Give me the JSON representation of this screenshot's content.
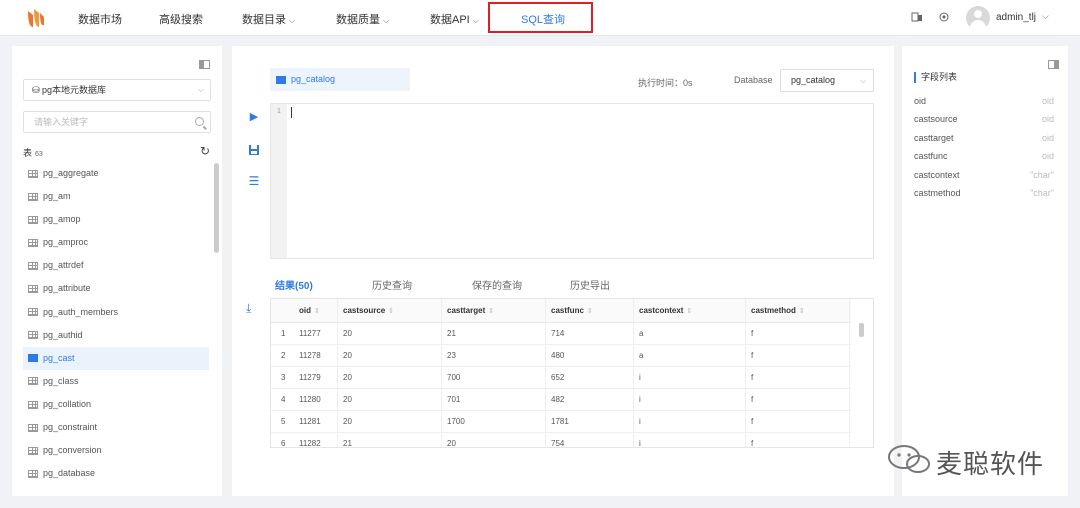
{
  "nav": {
    "items": [
      {
        "label": "数据市场",
        "dropdown": false
      },
      {
        "label": "高级搜索",
        "dropdown": false
      },
      {
        "label": "数据目录",
        "dropdown": true
      },
      {
        "label": "数据质量",
        "dropdown": true
      },
      {
        "label": "数据API",
        "dropdown": true
      },
      {
        "label": "SQL查询",
        "dropdown": false,
        "active": true
      }
    ],
    "username": "admin_tlj",
    "icons": [
      "notification-icon",
      "settings-icon"
    ]
  },
  "left": {
    "datasource": "pg本地元数据库",
    "search_placeholder": "请输入关键字",
    "table_label": "表",
    "table_count": "63",
    "tables": [
      "pg_aggregate",
      "pg_am",
      "pg_amop",
      "pg_amproc",
      "pg_attrdef",
      "pg_attribute",
      "pg_auth_members",
      "pg_authid",
      "pg_cast",
      "pg_class",
      "pg_collation",
      "pg_constraint",
      "pg_conversion",
      "pg_database"
    ],
    "selected_table": "pg_cast"
  },
  "editor": {
    "tab_label": "pg_catalog",
    "exec_time": "执行时间：0s",
    "database_label": "Database",
    "database_value": "pg_catalog",
    "line_number": "1"
  },
  "results": {
    "tabs": [
      "结果(50)",
      "历史查询",
      "保存的查询",
      "历史导出"
    ],
    "columns": [
      "oid",
      "castsource",
      "casttarget",
      "castfunc",
      "castcontext",
      "castmethod"
    ],
    "rows": [
      [
        "1",
        "11277",
        "20",
        "21",
        "714",
        "a",
        "f"
      ],
      [
        "2",
        "11278",
        "20",
        "23",
        "480",
        "a",
        "f"
      ],
      [
        "3",
        "11279",
        "20",
        "700",
        "652",
        "i",
        "f"
      ],
      [
        "4",
        "11280",
        "20",
        "701",
        "482",
        "i",
        "f"
      ],
      [
        "5",
        "11281",
        "20",
        "1700",
        "1781",
        "i",
        "f"
      ],
      [
        "6",
        "11282",
        "21",
        "20",
        "754",
        "i",
        "f"
      ]
    ]
  },
  "fields": {
    "title": "字段列表",
    "items": [
      {
        "name": "oid",
        "type": "oid"
      },
      {
        "name": "castsource",
        "type": "oid"
      },
      {
        "name": "casttarget",
        "type": "oid"
      },
      {
        "name": "castfunc",
        "type": "oid"
      },
      {
        "name": "castcontext",
        "type": "\"char\""
      },
      {
        "name": "castmethod",
        "type": "\"char\""
      }
    ]
  },
  "watermark": {
    "text": "麦聪软件"
  },
  "colors": {
    "accent": "#2f7be6",
    "highlight_box": "#e02020",
    "selected_bg": "#eaf2fc"
  }
}
